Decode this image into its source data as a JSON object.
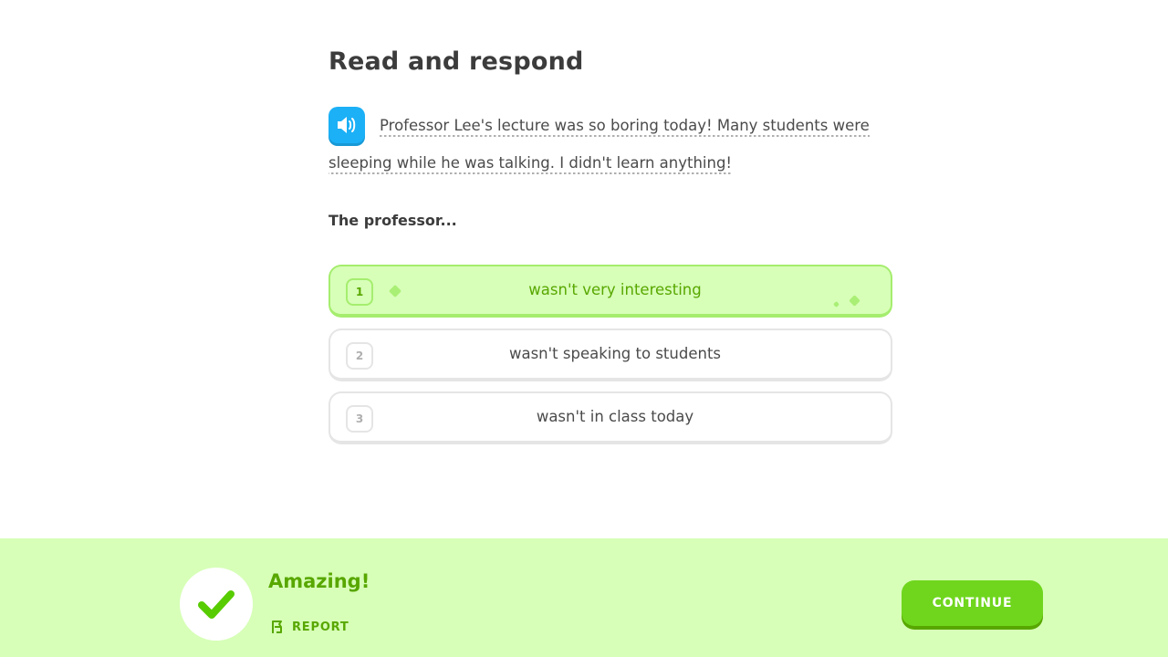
{
  "lesson": {
    "title": "Read and respond",
    "passage": "Professor Lee's lecture was so boring today! Many students were sleeping while he was talking. I didn't learn anything!",
    "prompt": "The professor...",
    "choices": [
      {
        "number": "1",
        "label": "wasn't very interesting",
        "selected": true
      },
      {
        "number": "2",
        "label": "wasn't speaking to students",
        "selected": false
      },
      {
        "number": "3",
        "label": "wasn't in class today",
        "selected": false
      }
    ]
  },
  "footer": {
    "feedback": "Amazing!",
    "report_label": "REPORT",
    "continue_label": "CONTINUE"
  },
  "colors": {
    "accent_green": "#58cc02",
    "feedback_bg": "#d7ffb8",
    "speaker_blue": "#1cb0f6"
  },
  "icons": {
    "speaker": "speaker-icon",
    "check": "checkmark-icon",
    "report": "flag-icon"
  }
}
